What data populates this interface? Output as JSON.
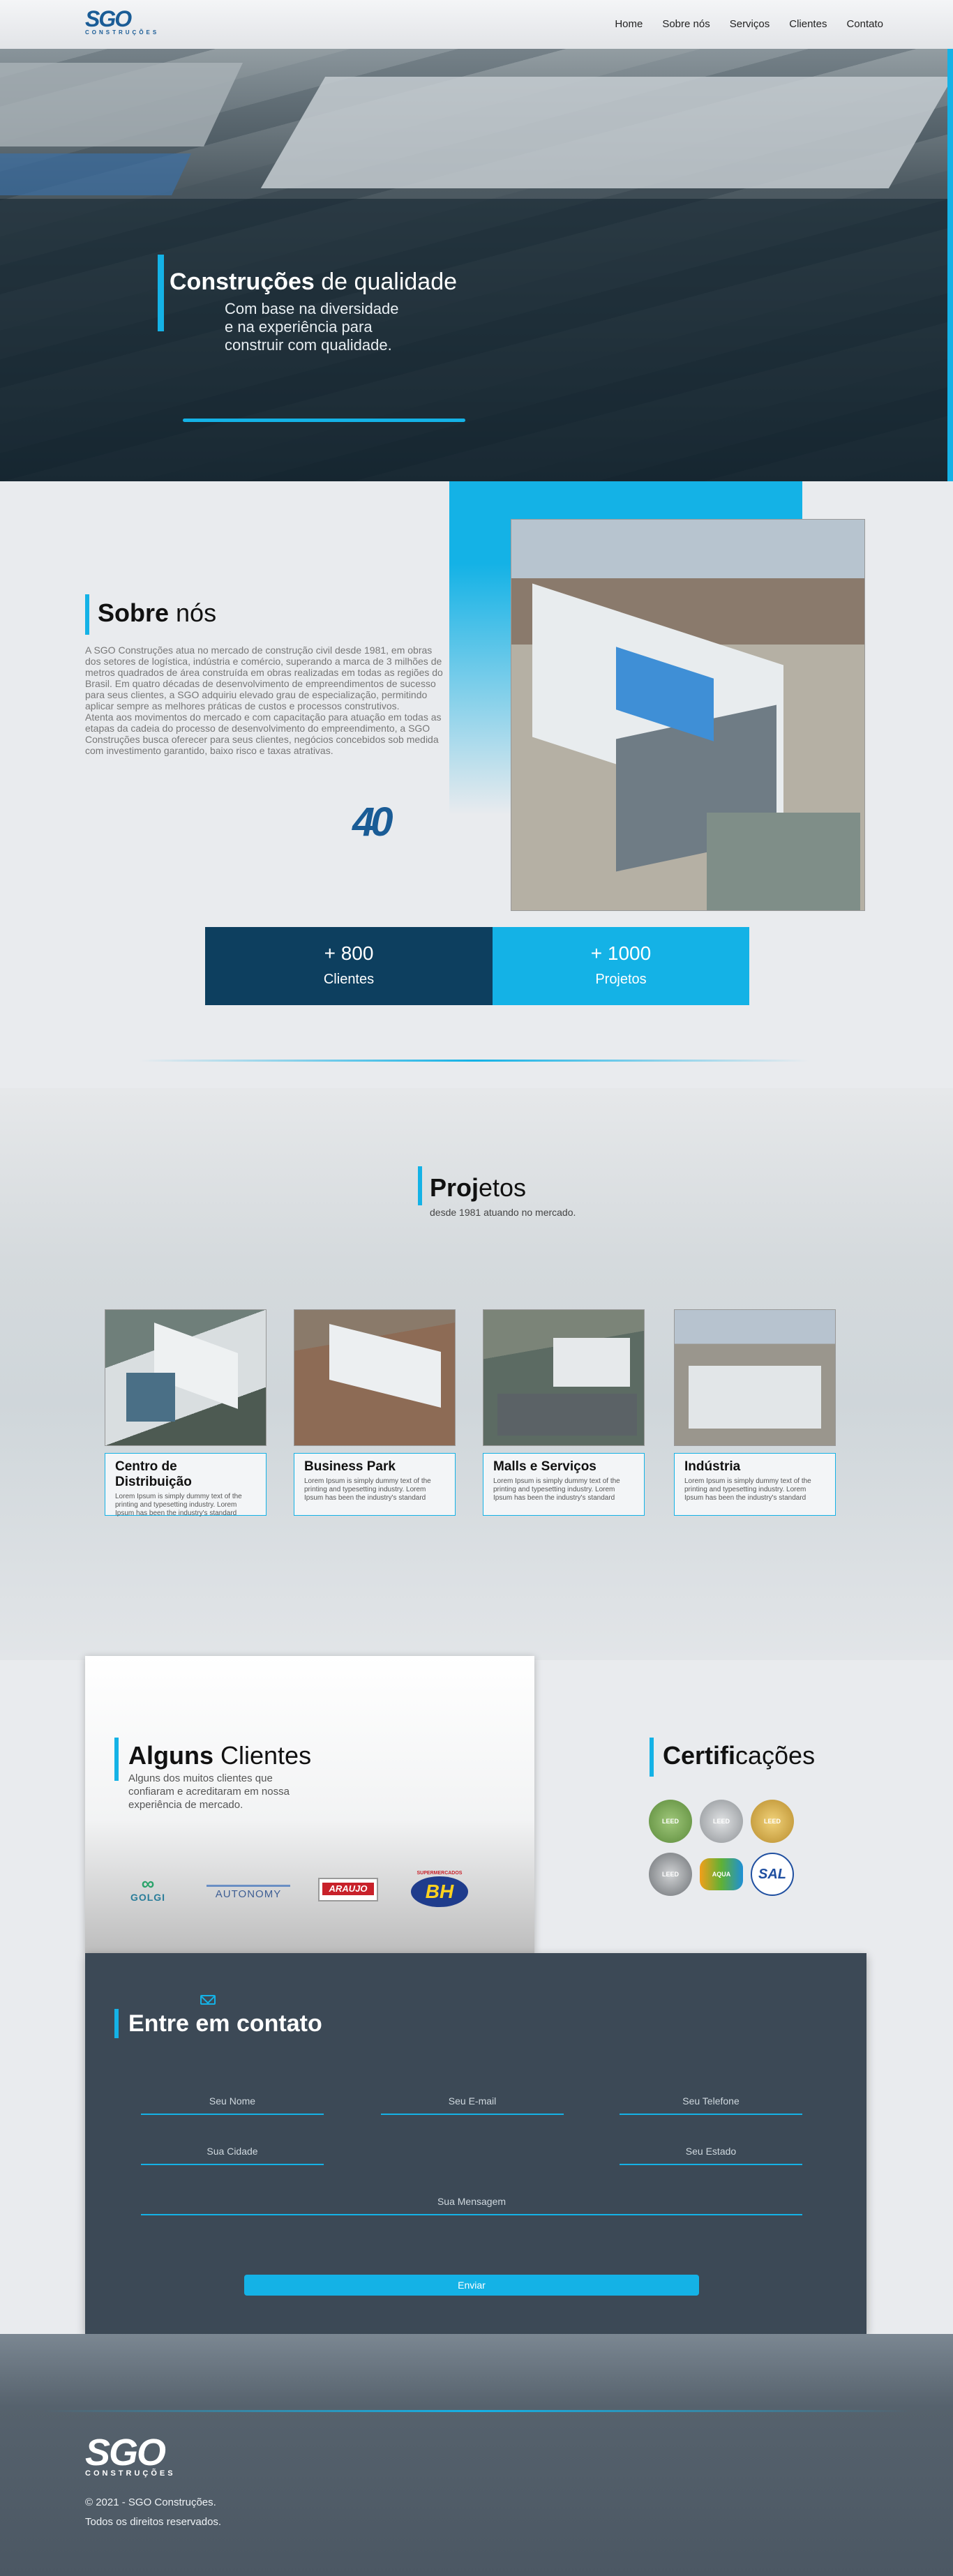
{
  "header": {
    "logo": "SGO",
    "logo_sub": "CONSTRUÇÕES",
    "nav": [
      "Home",
      "Sobre nós",
      "Serviços",
      "Clientes",
      "Contato"
    ]
  },
  "hero": {
    "title_bold": "Construções",
    "title_rest": " de qualidade",
    "subtitle_lines": [
      "Com base na diversidade",
      "e na experiência para",
      "construir com qualidade."
    ]
  },
  "about": {
    "title_bold": "Sobre",
    "title_rest": " nós",
    "text": "A SGO Construções atua no mercado de construção civil desde 1981, em obras dos setores de logística, indústria e comércio, superando a marca de 3 milhões de metros quadrados de área construída em obras realizadas em todas as regiões do Brasil. Em quatro décadas de desenvolvimento de empreendimentos de sucesso para seus clientes, a SGO adquiriu elevado grau de especialização, permitindo aplicar sempre as melhores práticas de custos e processos construtivos.\nAtenta aos movimentos do mercado e com capacitação para atuação em todas as etapas da cadeia do processo de desenvolvimento do empreendimento, a SGO Construções busca oferecer para seus clientes, negócios concebidos sob medida com investimento garantido, baixo risco e taxas atrativas.",
    "badge": "40",
    "stats": [
      {
        "number": "+  800",
        "label": "Clientes"
      },
      {
        "number": "+ 1000",
        "label": "Projetos"
      }
    ]
  },
  "projects": {
    "title_bold": "Proj",
    "title_rest": "etos",
    "subtitle": "desde 1981 atuando no mercado.",
    "cards": [
      {
        "title": "Centro de Distribuição",
        "text": "Lorem Ipsum is simply dummy text of the printing and typesetting industry. Lorem Ipsum has been the industry's standard"
      },
      {
        "title": "Business Park",
        "text": "Lorem Ipsum is simply dummy text of the printing and typesetting industry. Lorem Ipsum has been the industry's standard"
      },
      {
        "title": "Malls e Serviços",
        "text": "Lorem Ipsum is simply dummy text of the printing and typesetting industry. Lorem Ipsum has been the industry's standard"
      },
      {
        "title": "Indústria",
        "text": "Lorem Ipsum is simply dummy text of the printing and typesetting industry. Lorem Ipsum has been the industry's standard"
      }
    ]
  },
  "clients": {
    "title_bold": "Alguns",
    "title_rest": " Clientes",
    "subtitle": "Alguns dos muitos clientes que confiaram e acreditaram em nossa experiência de mercado.",
    "logos": [
      "GOLGI",
      "AUTONOMY",
      "ARAUJO",
      "BH"
    ],
    "logo_small": "SUPERMERCADOS"
  },
  "certifications": {
    "title_bold": "Certifi",
    "title_rest": "cações",
    "seals": [
      "LEED",
      "LEED",
      "LEED",
      "LEED",
      "AQUA",
      "SAL"
    ]
  },
  "contact": {
    "title": "Entre em contato",
    "fields": {
      "name": "Seu Nome",
      "email": "Seu E-mail",
      "phone": "Seu Telefone",
      "city": "Sua Cidade",
      "state": "Seu Estado",
      "message": "Sua Mensagem"
    },
    "submit": "Enviar"
  },
  "footer": {
    "logo": "SGO",
    "logo_sub": "CONSTRUÇÕES",
    "copyright": "© 2021 - SGO Construções.",
    "rights": "Todos os direitos reservados."
  },
  "colors": {
    "accent": "#14b2e6",
    "navy": "#0d3f5f",
    "contact_bg": "#3c4956"
  }
}
